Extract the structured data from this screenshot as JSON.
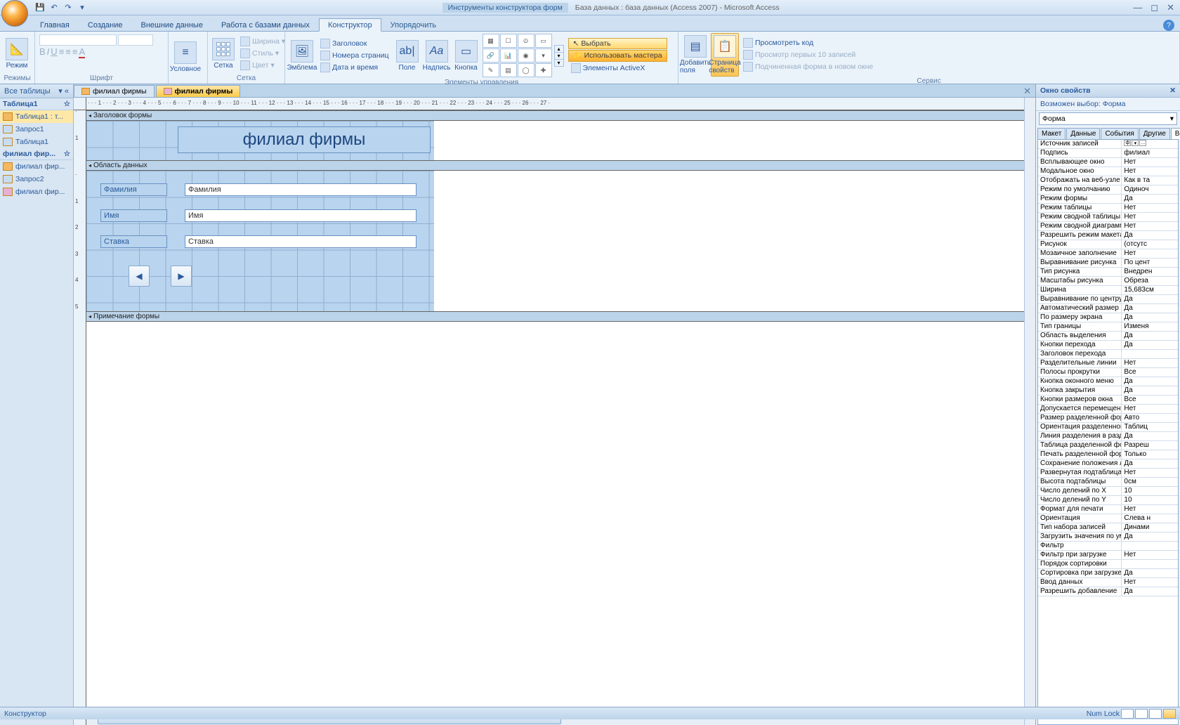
{
  "title_context": "Инструменты конструктора форм",
  "title_main": "База данных : база данных (Access 2007) - Microsoft Access",
  "tabs": {
    "home": "Главная",
    "create": "Создание",
    "external": "Внешние данные",
    "dbtools": "Работа с базами данных",
    "design": "Конструктор",
    "arrange": "Упорядочить"
  },
  "ribbon": {
    "modes": "Режим",
    "modes_group": "Режимы",
    "font_group": "Шрифт",
    "conditional": "Условное",
    "grid": "Сетка",
    "width": "Ширина",
    "style": "Стиль",
    "color": "Цвет",
    "grid_group": "Сетка",
    "logo": "Эмблема",
    "header_btn": "Заголовок",
    "pagenums": "Номера страниц",
    "datetime": "Дата и время",
    "field": "Поле",
    "label": "Надпись",
    "button": "Кнопка",
    "controls_group": "Элементы управления",
    "select": "Выбрать",
    "use_wizards": "Использовать мастера",
    "activex": "Элементы ActiveX",
    "add_fields": "Добавить поля",
    "prop_sheet": "Страница свойств",
    "view_code": "Просмотреть код",
    "view_top": "Просмотр первых 10 записей",
    "subform": "Подчиненная форма в новом окне",
    "service_group": "Сервис"
  },
  "nav": {
    "header": "Все таблицы",
    "group1": "Таблица1",
    "item1": "Таблица1 : т...",
    "item2": "Запрос1",
    "item3": "Таблица1",
    "group2": "филиал фир...",
    "item4": "филиал фир...",
    "item5": "Запрос2",
    "item6": "филиал фир..."
  },
  "doctabs": {
    "tab1": "филиал фирмы",
    "tab2": "филиал фирмы"
  },
  "ruler_text": "· · · 1 · · · 2 · · · 3 · · · 4 · · · 5 · · · 6 · · · 7 · · · 8 · · · 9 · · · 10 · · · 11 · · · 12 · · · 13 · · · 14 · · · 15 · · · 16 · · · 17 · · · 18 · · · 19 · · · 20 · · · 21 · · · 22 · · · 23 · · · 24 · · · 25 · · · 26 · · · 27 · ",
  "sections": {
    "header": "Заголовок формы",
    "detail": "Область данных",
    "footer": "Примечание формы"
  },
  "form": {
    "title": "филиал фирмы",
    "f1_label": "Фамилия",
    "f1_bound": "Фамилия",
    "f2_label": "Имя",
    "f2_bound": "Имя",
    "f3_label": "Ставка",
    "f3_bound": "Ставка"
  },
  "props": {
    "title": "Окно свойств",
    "subtitle": "Возможен выбор:  Форма",
    "selector": "Форма",
    "tabs": {
      "layout": "Макет",
      "data": "Данные",
      "events": "События",
      "other": "Другие",
      "all": "Все"
    },
    "rows": [
      {
        "k": "Источник записей",
        "v": ""
      },
      {
        "k": "Подпись",
        "v": "филиал"
      },
      {
        "k": "Всплывающее окно",
        "v": "Нет"
      },
      {
        "k": "Модальное окно",
        "v": "Нет"
      },
      {
        "k": "Отображать на веб-узле SharePoint",
        "v": "Как в та"
      },
      {
        "k": "Режим по умолчанию",
        "v": "Одиноч"
      },
      {
        "k": "Режим формы",
        "v": "Да"
      },
      {
        "k": "Режим таблицы",
        "v": "Нет"
      },
      {
        "k": "Режим сводной таблицы",
        "v": "Нет"
      },
      {
        "k": "Режим сводной диаграммы",
        "v": "Нет"
      },
      {
        "k": "Разрешить режим макета",
        "v": "Да"
      },
      {
        "k": "Рисунок",
        "v": "(отсутс"
      },
      {
        "k": "Мозаичное заполнение",
        "v": "Нет"
      },
      {
        "k": "Выравнивание рисунка",
        "v": "По цент"
      },
      {
        "k": "Тип рисунка",
        "v": "Внедрен"
      },
      {
        "k": "Масштабы рисунка",
        "v": "Обреза"
      },
      {
        "k": "Ширина",
        "v": "15,683см"
      },
      {
        "k": "Выравнивание по центру",
        "v": "Да"
      },
      {
        "k": "Автоматический размер",
        "v": "Да"
      },
      {
        "k": "По размеру экрана",
        "v": "Да"
      },
      {
        "k": "Тип границы",
        "v": "Изменя"
      },
      {
        "k": "Область выделения",
        "v": "Да"
      },
      {
        "k": "Кнопки перехода",
        "v": "Да"
      },
      {
        "k": "Заголовок перехода",
        "v": ""
      },
      {
        "k": "Разделительные линии",
        "v": "Нет"
      },
      {
        "k": "Полосы прокрутки",
        "v": "Все"
      },
      {
        "k": "Кнопка оконного меню",
        "v": "Да"
      },
      {
        "k": "Кнопка закрытия",
        "v": "Да"
      },
      {
        "k": "Кнопки размеров окна",
        "v": "Все"
      },
      {
        "k": "Допускается перемещение",
        "v": "Нет"
      },
      {
        "k": "Размер разделенной формы",
        "v": "Авто"
      },
      {
        "k": "Ориентация разделенной формы",
        "v": "Таблиц"
      },
      {
        "k": "Линия разделения в разделенной ф",
        "v": "Да"
      },
      {
        "k": "Таблица разделенной формы",
        "v": "Разреш"
      },
      {
        "k": "Печать разделенной формы",
        "v": "Только"
      },
      {
        "k": "Сохранение положения линии раз",
        "v": "Да"
      },
      {
        "k": "Развернутая подтаблица",
        "v": "Нет"
      },
      {
        "k": "Высота подтаблицы",
        "v": "0см"
      },
      {
        "k": "Число делений по X",
        "v": "10"
      },
      {
        "k": "Число делений по Y",
        "v": "10"
      },
      {
        "k": "Формат для печати",
        "v": "Нет"
      },
      {
        "k": "Ориентация",
        "v": "Слева н"
      },
      {
        "k": "Тип набора записей",
        "v": "Динами"
      },
      {
        "k": "Загрузить значения по умолчанию",
        "v": "Да"
      },
      {
        "k": "Фильтр",
        "v": ""
      },
      {
        "k": "Фильтр при загрузке",
        "v": "Нет"
      },
      {
        "k": "Порядок сортировки",
        "v": ""
      },
      {
        "k": "Сортировка при загрузке",
        "v": "Да"
      },
      {
        "k": "Ввод данных",
        "v": "Нет"
      },
      {
        "k": "Разрешить добавление",
        "v": "Да"
      }
    ]
  },
  "status": {
    "left": "Конструктор",
    "numlock": "Num Lock"
  }
}
